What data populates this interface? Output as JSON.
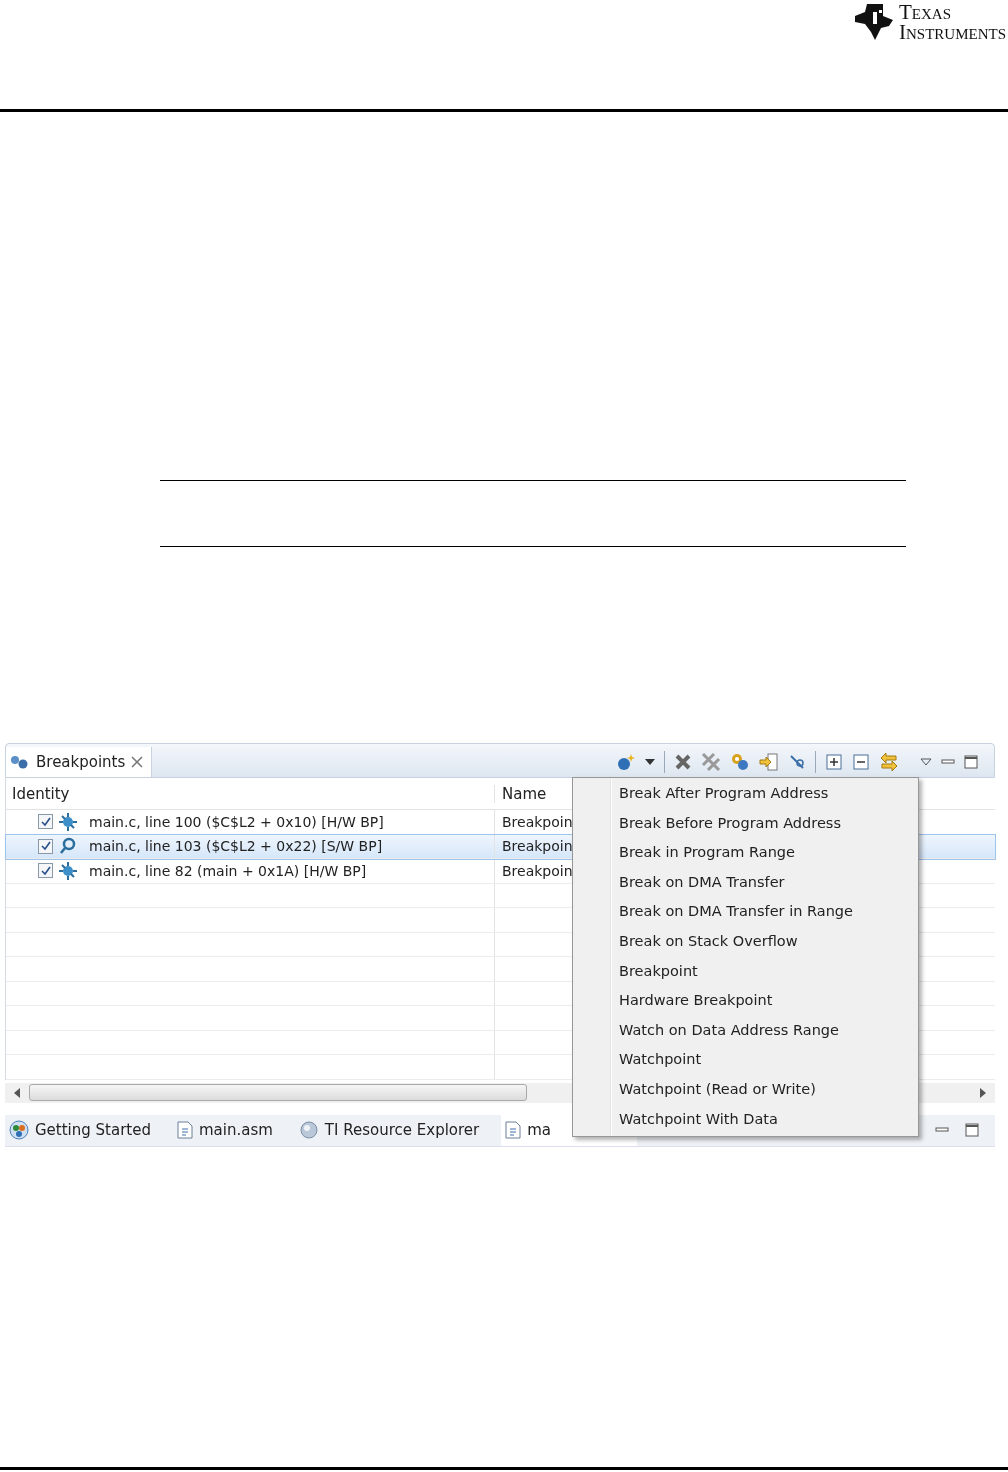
{
  "logo": {
    "line1": "Texas",
    "line2": "Instruments"
  },
  "view": {
    "tab": {
      "label": "Breakpoints",
      "selected": true
    },
    "columns": [
      "Identity",
      "Name"
    ],
    "rows": [
      {
        "identity": "main.c, line 100 ($C$L2 + 0x10)  [H/W BP]",
        "name": "Breakpoin",
        "kind": "hardware",
        "checked": true,
        "selected": false
      },
      {
        "identity": "main.c, line 103 ($C$L2 + 0x22)  [S/W BP]",
        "name": "Breakpoin",
        "kind": "software",
        "checked": true,
        "selected": true
      },
      {
        "identity": "main.c, line 82 (main + 0x1A)  [H/W BP]",
        "name": "Breakpoin",
        "kind": "hardware",
        "checked": true,
        "selected": false
      }
    ],
    "menu": [
      "Break After Program Address",
      "Break Before Program Address",
      "Break in Program Range",
      "Break on DMA Transfer",
      "Break on DMA Transfer in Range",
      "Break on Stack Overflow",
      "Breakpoint",
      "Hardware Breakpoint",
      "Watch on Data Address Range",
      "Watchpoint",
      "Watchpoint (Read or Write)",
      "Watchpoint With Data"
    ],
    "bottom_tabs": [
      {
        "label": "Getting Started",
        "kind": "welcome",
        "selected": false
      },
      {
        "label": "main.asm",
        "kind": "asm",
        "selected": false
      },
      {
        "label": "TI Resource Explorer",
        "kind": "globe",
        "selected": false
      },
      {
        "label": "ma",
        "kind": "c",
        "selected": true
      }
    ]
  }
}
